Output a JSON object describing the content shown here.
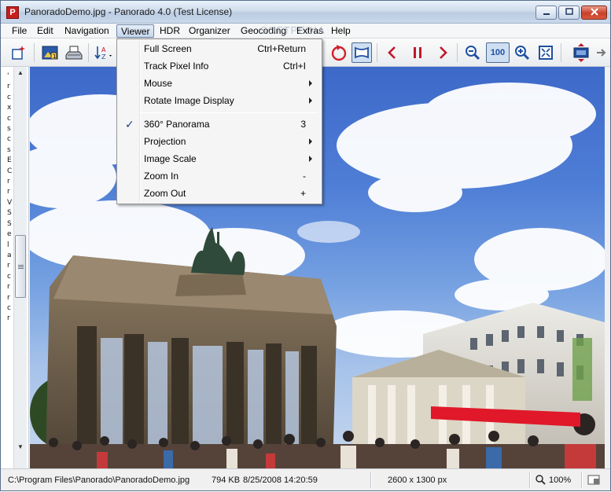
{
  "window": {
    "title": "PanoradoDemo.jpg  -  Panorado 4.0 (Test License)",
    "app_icon_letter": "P"
  },
  "menubar": {
    "items": [
      "File",
      "Edit",
      "Navigation",
      "Viewer",
      "HDR",
      "Organizer",
      "Geocoding",
      "Extras",
      "Help"
    ],
    "active": "Viewer",
    "watermark": "SOFTPEDIA"
  },
  "viewer_menu": {
    "items": [
      {
        "label": "Full Screen",
        "shortcut": "Ctrl+Return"
      },
      {
        "label": "Track Pixel Info",
        "shortcut": "Ctrl+I"
      },
      {
        "label": "Mouse",
        "submenu": true
      },
      {
        "label": "Rotate Image Display",
        "submenu": true
      },
      {
        "label": "360° Panorama",
        "shortcut": "3",
        "checked": true
      },
      {
        "label": "Projection",
        "submenu": true
      },
      {
        "label": "Image Scale",
        "submenu": true
      },
      {
        "label": "Zoom In",
        "shortcut": "-"
      },
      {
        "label": "Zoom Out",
        "shortcut": "+"
      }
    ],
    "check_glyph": "✓"
  },
  "toolbar": {
    "zoom_100_label": "100"
  },
  "left_panel": {
    "glyphs": [
      "'",
      "r",
      "c",
      "x",
      "c",
      "s",
      "c",
      "s",
      "E",
      "C",
      "r",
      "r",
      "V",
      "S",
      "S",
      "e",
      "l",
      "a",
      "r",
      "c",
      "r",
      "r",
      "c",
      "r"
    ]
  },
  "statusbar": {
    "path": "C:\\Program Files\\Panorado\\PanoradoDemo.jpg",
    "size": "794 KB",
    "date": "8/25/2008 14:20:59",
    "dimensions": "2600 x 1300 px",
    "zoom": "100%"
  },
  "colors": {
    "accent": "#1b3f8b",
    "toolbar_red": "#c0182a",
    "toolbar_blue": "#1f4fa0"
  }
}
